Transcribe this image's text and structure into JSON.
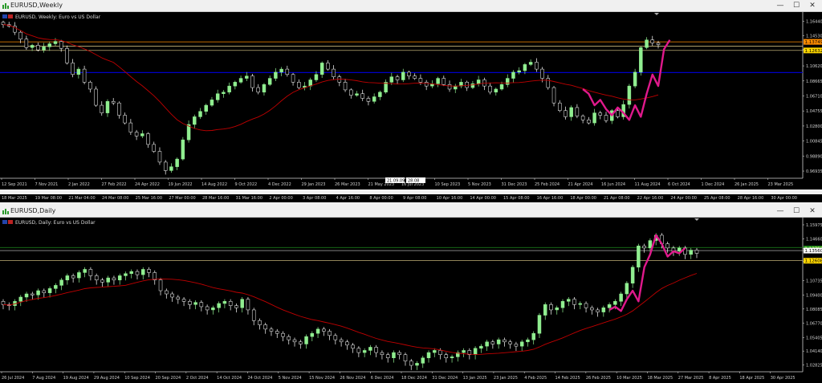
{
  "colors": {
    "background": "#000000",
    "bull_candle": "#90ee90",
    "bear_candle": "#ffffff",
    "moving_average": "#c00000",
    "annotation": "#e0198c",
    "level_line": "#e6d28c",
    "blue_line": "#0000c8",
    "orange_label": "#ff8c00",
    "yellow_label": "#ffd700",
    "green_label": "#1e8c1e"
  },
  "window_top": {
    "title": "EURUSD,Weekly",
    "symbol_label": "EURUSD, Weekly:  Euro vs US Dollar",
    "icons": [
      "chart-window-icon"
    ],
    "controls": {
      "minimize": "—",
      "maximize": "☐",
      "close": "✕"
    },
    "price_axis": [
      "1.16440",
      "1.14530",
      "1.12749",
      "1.12632",
      "1.10620",
      "1.08665",
      "1.06710",
      "1.04755",
      "1.02800",
      "1.00845",
      "0.98890",
      "0.96935"
    ],
    "price_labels": {
      "orange": "1.13749",
      "yellow": "1.12632"
    },
    "time_axis": [
      "12 Sep 2021",
      "7 Nov 2021",
      "2 Jan 2022",
      "27 Feb 2022",
      "24 Apr 2022",
      "19 Jun 2022",
      "14 Aug 2022",
      "9 Oct 2022",
      "4 Dec 2022",
      "29 Jan 2023",
      "26 Mar 2023",
      "21 May 2023",
      "16 Jul 2023",
      "10 Sep 2023",
      "5 Nov 2023",
      "31 Dec 2023",
      "25 Feb 2024",
      "21 Apr 2024",
      "16 Jun 2024",
      "11 Aug 2024",
      "6 Oct 2024",
      "1 Dec 2024",
      "26 Jan 2025",
      "23 Mar 2025"
    ],
    "crosshair_labels": [
      "21.09.09",
      "28.08"
    ]
  },
  "middle_strip": {
    "labels": [
      "18 Mar 2025",
      "19 Mar 08:00",
      "21 Mar 04:00",
      "24 Mar 08:00",
      "25 Mar 16:00",
      "27 Mar 00:00",
      "28 Mar 16:00",
      "31 Mar 16:00",
      "2 Apr 00:00",
      "3 Apr 08:00",
      "4 Apr 16:00",
      "8 Apr 00:00",
      "9 Apr 08:00",
      "10 Apr 16:00",
      "14 Apr 00:00",
      "15 Apr 08:00",
      "16 Apr 16:00",
      "18 Apr 00:00",
      "21 Apr 08:00",
      "22 Apr 16:00",
      "24 Apr 00:00",
      "25 Apr 08:00",
      "28 Apr 16:00",
      "30 Apr 00:00"
    ]
  },
  "window_bottom": {
    "title": "EURUSD,Daily",
    "symbol_label": "EURUSD, Daily:  Euro vs US Dollar",
    "controls": {
      "minimize": "—",
      "maximize": "☐",
      "close": "✕"
    },
    "price_axis": [
      "1.15975",
      "1.14660",
      "1.13752",
      "1.13560",
      "1.12530",
      "1.10735",
      "1.09400",
      "1.08085",
      "1.06770",
      "1.05405",
      "1.04140",
      "1.02825"
    ],
    "price_labels": {
      "green": "1.13752",
      "white": "1.13560",
      "yellow": "1.12608"
    },
    "time_axis": [
      "26 Jul 2024",
      "7 Aug 2024",
      "19 Aug 2024",
      "29 Aug 2024",
      "10 Sep 2024",
      "20 Sep 2024",
      "2 Oct 2024",
      "14 Oct 2024",
      "24 Oct 2024",
      "5 Nov 2024",
      "15 Nov 2024",
      "26 Nov 2024",
      "6 Dec 2024",
      "18 Dec 2024",
      "31 Dec 2024",
      "13 Jan 2025",
      "23 Jan 2025",
      "4 Feb 2025",
      "14 Feb 2025",
      "26 Feb 2025",
      "10 Mar 2025",
      "18 Mar 2025",
      "27 Mar 2025",
      "8 Apr 2025",
      "18 Apr 2025",
      "30 Apr 2025"
    ]
  },
  "chart_data": [
    {
      "type": "candlestick",
      "title": "EURUSD, Weekly:  Euro vs US Dollar",
      "ylim": [
        0.96,
        1.17
      ],
      "close_series": [
        1.16,
        1.158,
        1.15,
        1.141,
        1.13,
        1.133,
        1.127,
        1.131,
        1.135,
        1.138,
        1.129,
        1.11,
        1.095,
        1.102,
        1.085,
        1.076,
        1.055,
        1.045,
        1.06,
        1.058,
        1.042,
        1.032,
        1.02,
        1.015,
        1.018,
        1.004,
        0.995,
        0.981,
        0.97,
        0.975,
        0.985,
        1.01,
        1.03,
        1.04,
        1.047,
        1.055,
        1.062,
        1.07,
        1.072,
        1.08,
        1.085,
        1.09,
        1.093,
        1.078,
        1.072,
        1.082,
        1.09,
        1.098,
        1.102,
        1.095,
        1.085,
        1.078,
        1.08,
        1.088,
        1.095,
        1.11,
        1.102,
        1.092,
        1.085,
        1.075,
        1.068,
        1.07,
        1.064,
        1.06,
        1.066,
        1.072,
        1.085,
        1.092,
        1.088,
        1.098,
        1.093,
        1.09,
        1.085,
        1.08,
        1.083,
        1.09,
        1.082,
        1.076,
        1.08,
        1.085,
        1.078,
        1.083,
        1.088,
        1.08,
        1.072,
        1.076,
        1.082,
        1.09,
        1.098,
        1.1,
        1.108,
        1.111,
        1.102,
        1.09,
        1.078,
        1.058,
        1.048,
        1.04,
        1.052,
        1.041,
        1.036,
        1.032,
        1.045,
        1.042,
        1.035,
        1.048,
        1.04,
        1.056,
        1.08,
        1.098,
        1.13,
        1.14,
        1.136,
        1.134
      ],
      "ma_series_note": "red moving average"
    },
    {
      "type": "candlestick",
      "title": "EURUSD, Daily:  Euro vs US Dollar",
      "ylim": [
        1.022,
        1.162
      ],
      "close_series": [
        1.085,
        1.084,
        1.088,
        1.092,
        1.095,
        1.094,
        1.098,
        1.096,
        1.1,
        1.103,
        1.108,
        1.112,
        1.11,
        1.115,
        1.118,
        1.112,
        1.108,
        1.106,
        1.11,
        1.108,
        1.112,
        1.114,
        1.116,
        1.113,
        1.118,
        1.115,
        1.108,
        1.098,
        1.095,
        1.092,
        1.09,
        1.088,
        1.085,
        1.087,
        1.083,
        1.08,
        1.082,
        1.086,
        1.088,
        1.084,
        1.082,
        1.09,
        1.08,
        1.07,
        1.066,
        1.062,
        1.06,
        1.058,
        1.055,
        1.052,
        1.05,
        1.048,
        1.055,
        1.058,
        1.062,
        1.06,
        1.056,
        1.052,
        1.05,
        1.047,
        1.044,
        1.04,
        1.042,
        1.045,
        1.04,
        1.038,
        1.035,
        1.04,
        1.038,
        1.032,
        1.028,
        1.03,
        1.035,
        1.04,
        1.042,
        1.038,
        1.035,
        1.036,
        1.04,
        1.042,
        1.038,
        1.044,
        1.046,
        1.05,
        1.048,
        1.052,
        1.05,
        1.048,
        1.046,
        1.05,
        1.052,
        1.058,
        1.075,
        1.085,
        1.08,
        1.082,
        1.088,
        1.09,
        1.085,
        1.086,
        1.082,
        1.08,
        1.078,
        1.082,
        1.085,
        1.088,
        1.095,
        1.105,
        1.12,
        1.14,
        1.138,
        1.145,
        1.15,
        1.142,
        1.138,
        1.135,
        1.138,
        1.132,
        1.136,
        1.133
      ],
      "ma_series_note": "red moving average"
    }
  ]
}
